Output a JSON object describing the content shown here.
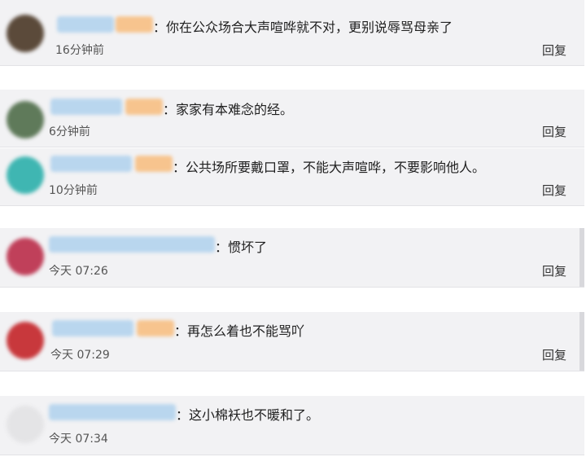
{
  "comments": [
    {
      "text": "：你在公众场合大声喧哗就不对，更别说辱骂母亲了",
      "time": "16分钟前",
      "reply": "回复",
      "avatar_color": "#5b4a3a"
    },
    {
      "text": "：家家有本难念的经。",
      "time": "6分钟前",
      "reply": "回复",
      "avatar_color": "#5f7a5a"
    },
    {
      "text": "：公共场所要戴口罩，不能大声喧哗，不要影响他人。",
      "time": "10分钟前",
      "reply": "回复",
      "avatar_color": "#3fb6b2"
    },
    {
      "text": "：惯坏了",
      "time": "今天 07:26",
      "reply": "回复",
      "avatar_color": "#c0405a"
    },
    {
      "text": "：再怎么着也不能骂吖",
      "time": "今天 07:29",
      "reply": "回复",
      "avatar_color": "#c8383c"
    },
    {
      "text": "：这小棉袄也不暖和了。",
      "time": "今天 07:34",
      "reply": "回复",
      "avatar_color": "#e4e4e6"
    }
  ]
}
